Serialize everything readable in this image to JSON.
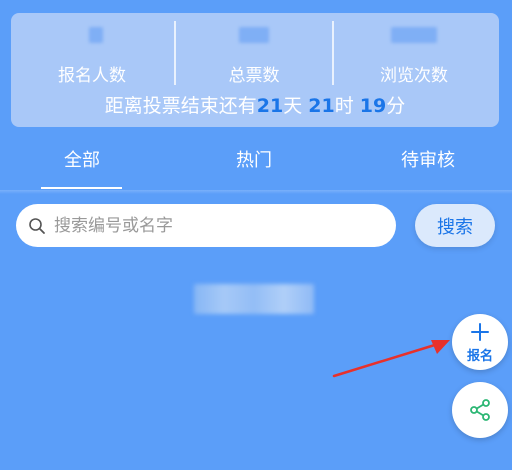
{
  "stats": {
    "items": [
      {
        "label": "报名人数"
      },
      {
        "label": "总票数"
      },
      {
        "label": "浏览次数"
      }
    ],
    "countdown": {
      "prefix": "距离投票结束还有",
      "days": "21",
      "days_unit": "天",
      "hours": "21",
      "hours_unit": "时",
      "minutes": "19",
      "minutes_unit": "分"
    }
  },
  "tabs": [
    {
      "label": "全部",
      "active": true
    },
    {
      "label": "热门",
      "active": false
    },
    {
      "label": "待审核",
      "active": false
    }
  ],
  "search": {
    "placeholder": "搜索编号或名字",
    "button_label": "搜索"
  },
  "fab": {
    "register_label": "报名"
  },
  "colors": {
    "background": "#5b9ef9",
    "accent": "#1a75e8",
    "share_icon": "#2bb673",
    "arrow": "#e8312b"
  },
  "icons": [
    "search-icon",
    "plus-icon",
    "share-icon"
  ]
}
